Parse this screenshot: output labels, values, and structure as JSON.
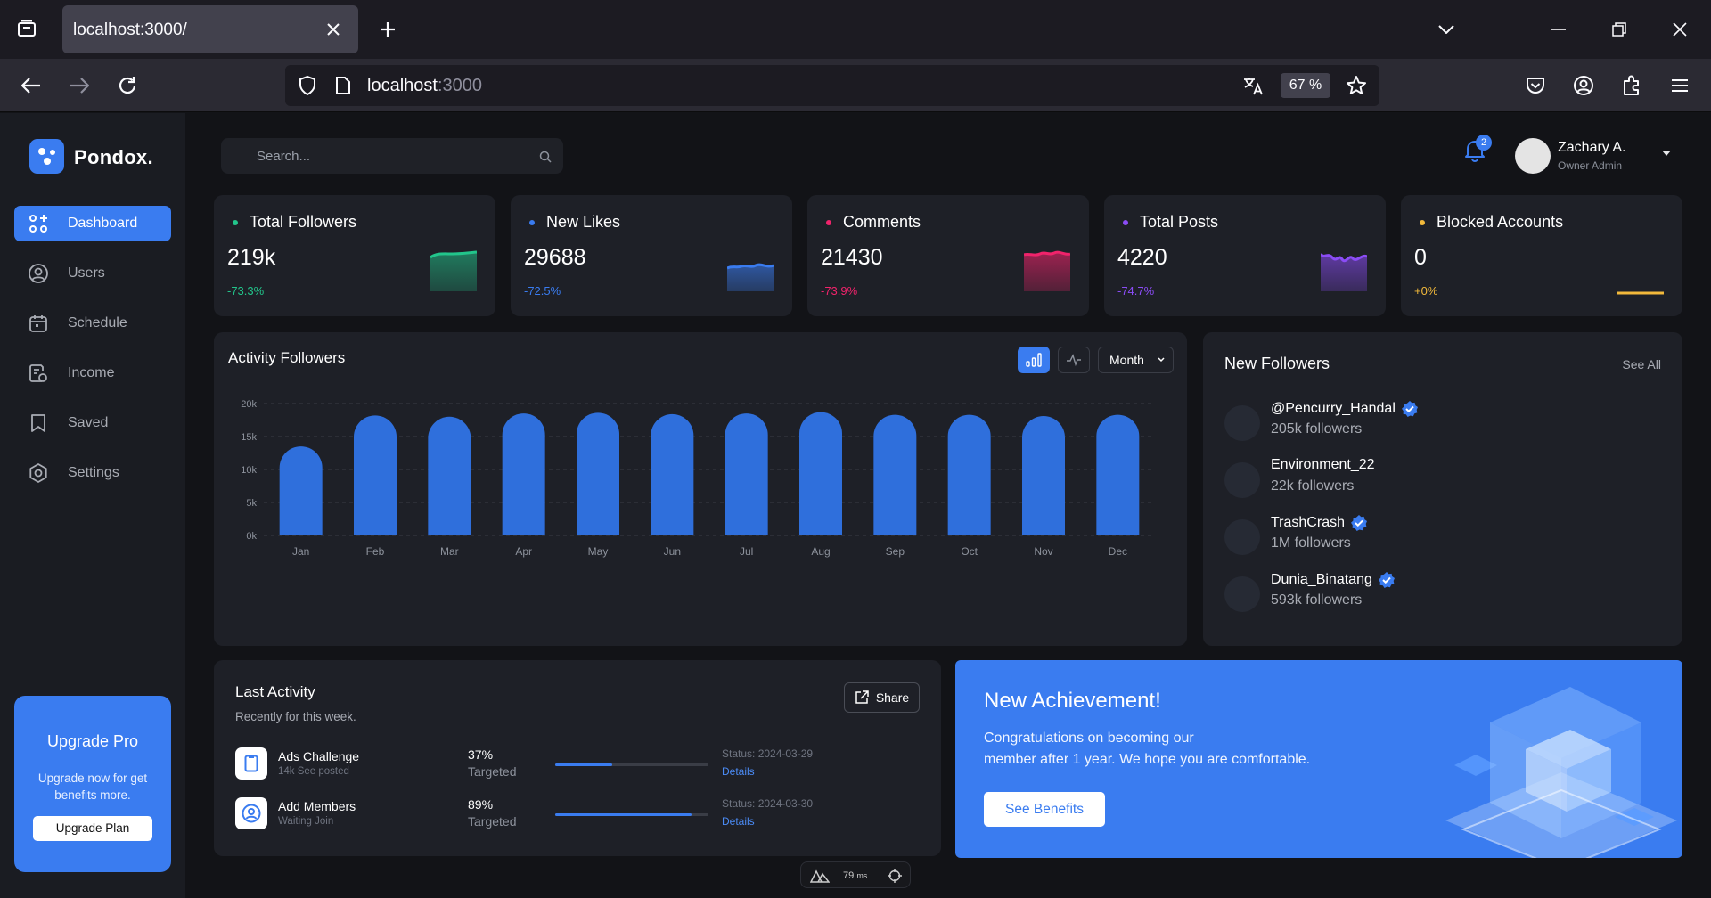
{
  "browser": {
    "tab_title": "localhost:3000/",
    "url_host": "localhost",
    "url_port": ":3000",
    "zoom": "67 %"
  },
  "sidebar": {
    "brand": "Pondox.",
    "items": [
      {
        "label": "Dashboard",
        "icon": "dashboard-icon",
        "active": true
      },
      {
        "label": "Users",
        "icon": "user-icon",
        "active": false
      },
      {
        "label": "Schedule",
        "icon": "calendar-icon",
        "active": false
      },
      {
        "label": "Income",
        "icon": "wallet-icon",
        "active": false
      },
      {
        "label": "Saved",
        "icon": "bookmark-icon",
        "active": false
      },
      {
        "label": "Settings",
        "icon": "gear-icon",
        "active": false
      }
    ],
    "upgrade": {
      "title": "Upgrade Pro",
      "description": "Upgrade now for get benefits more.",
      "button": "Upgrade Plan"
    }
  },
  "header": {
    "search_placeholder": "Search...",
    "notification_count": "2",
    "user_name": "Zachary A.",
    "user_role": "Owner Admin"
  },
  "stats": [
    {
      "label": "Total Followers",
      "value": "219k",
      "change": "-73.3%",
      "color": "#22c58b"
    },
    {
      "label": "New Likes",
      "value": "29688",
      "change": "-72.5%",
      "color": "#3a7cf0"
    },
    {
      "label": "Comments",
      "value": "21430",
      "change": "-73.9%",
      "color": "#f0236b"
    },
    {
      "label": "Total Posts",
      "value": "4220",
      "change": "-74.7%",
      "color": "#8b4cf6"
    },
    {
      "label": "Blocked Accounts",
      "value": "0",
      "change": "+0%",
      "color": "#f2b93b"
    }
  ],
  "activity": {
    "title": "Activity Followers",
    "period": "Month"
  },
  "chart_data": {
    "type": "bar",
    "title": "Activity Followers",
    "categories": [
      "Jan",
      "Feb",
      "Mar",
      "Apr",
      "May",
      "Jun",
      "Jul",
      "Aug",
      "Sep",
      "Oct",
      "Nov",
      "Dec"
    ],
    "values": [
      13500,
      18200,
      18000,
      18500,
      18600,
      18400,
      18500,
      18700,
      18300,
      18300,
      18100,
      18300
    ],
    "ylim": [
      0,
      20000
    ],
    "yticks": [
      "0k",
      "5k",
      "10k",
      "15k",
      "20k"
    ],
    "color": "#2f6fdc",
    "grid": true
  },
  "followers": {
    "title": "New Followers",
    "see_all": "See All",
    "items": [
      {
        "name": "@Pencurry_Handal",
        "count": "205k followers",
        "verified": true
      },
      {
        "name": "Environment_22",
        "count": "22k followers",
        "verified": false
      },
      {
        "name": "TrashCrash",
        "count": "1M followers",
        "verified": true
      },
      {
        "name": "Dunia_Binatang",
        "count": "593k followers",
        "verified": true
      }
    ]
  },
  "last_activity": {
    "title": "Last Activity",
    "subtitle": "Recently for this week.",
    "share": "Share",
    "items": [
      {
        "name": "Ads Challenge",
        "sub": "14k See posted",
        "percent": "37%",
        "target": "Targeted",
        "progress": 0.37,
        "status": "Status: 2024-03-29",
        "details": "Details",
        "icon": "document-icon"
      },
      {
        "name": "Add Members",
        "sub": "Waiting Join",
        "percent": "89%",
        "target": "Targeted",
        "progress": 0.89,
        "status": "Status: 2024-03-30",
        "details": "Details",
        "icon": "user-circle-icon"
      }
    ]
  },
  "achievement": {
    "title": "New Achievement!",
    "line1": "Congratulations on becoming our",
    "line2": "member after 1 year. We hope you are comfortable.",
    "button": "See Benefits"
  },
  "perf": {
    "ms": "79",
    "unit": "ms"
  }
}
